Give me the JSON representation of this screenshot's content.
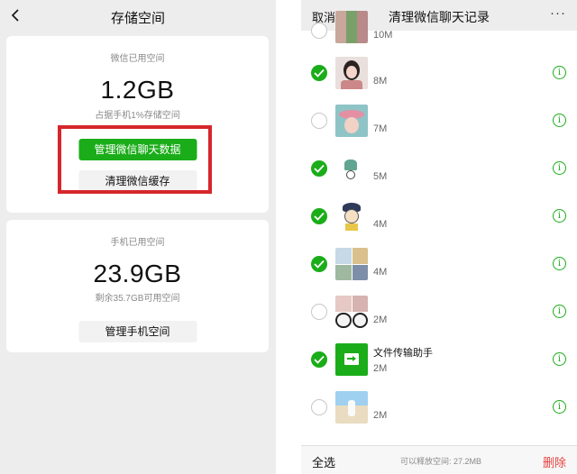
{
  "left": {
    "title": "存储空间",
    "wechat_card": {
      "label": "微信已用空间",
      "size": "1.2GB",
      "sub": "占据手机1%存储空间",
      "manage_chat_button": "管理微信聊天数据",
      "clear_cache_button": "清理微信缓存"
    },
    "phone_card": {
      "label": "手机已用空间",
      "size": "23.9GB",
      "sub": "剩余35.7GB可用空间",
      "manage_phone_button": "管理手机空间"
    },
    "colors": {
      "accent": "#1aad19",
      "highlight": "#d6262c"
    }
  },
  "right": {
    "cancel": "取消",
    "title": "清理微信聊天记录",
    "more": "···",
    "rows": [
      {
        "checked": false,
        "size": "10M",
        "name": "",
        "thumb": "thumb-photos"
      },
      {
        "checked": true,
        "size": "8M",
        "name": "",
        "thumb": "thumb-girl"
      },
      {
        "checked": false,
        "size": "7M",
        "name": "",
        "thumb": "thumb-hat"
      },
      {
        "checked": true,
        "size": "5M",
        "name": "",
        "thumb": "thumb-sketch"
      },
      {
        "checked": true,
        "size": "4M",
        "name": "",
        "thumb": "thumb-cartoon"
      },
      {
        "checked": true,
        "size": "4M",
        "name": "",
        "thumb": "thumb-grid"
      },
      {
        "checked": false,
        "size": "2M",
        "name": "",
        "thumb": "thumb-panda"
      },
      {
        "checked": true,
        "size": "2M",
        "name": "文件传输助手",
        "thumb": "thumb-file-transfer"
      },
      {
        "checked": false,
        "size": "2M",
        "name": "",
        "thumb": "thumb-beach"
      }
    ],
    "footer": {
      "select_all": "全选",
      "free_text": "可以释放空间: 27.2MB",
      "delete": "删除"
    },
    "colors": {
      "check": "#1aad19",
      "delete": "#e64340"
    }
  }
}
